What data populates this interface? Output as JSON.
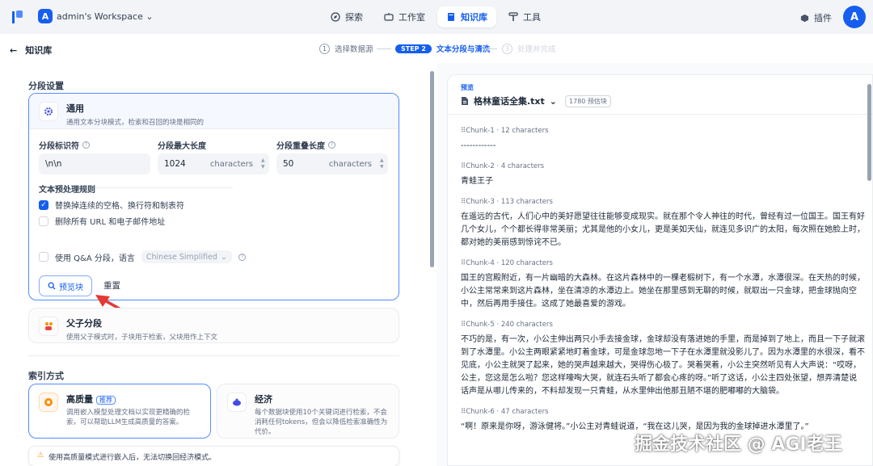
{
  "topbar": {
    "workspace_initial": "A",
    "workspace_name": "admin's Workspace",
    "nav": [
      {
        "label": "探索",
        "icon": "compass-icon"
      },
      {
        "label": "工作室",
        "icon": "studio-icon"
      },
      {
        "label": "知识库",
        "icon": "book-icon",
        "active": true
      },
      {
        "label": "工具",
        "icon": "tool-icon"
      }
    ],
    "plugin_label": "插件",
    "user_initial": "A"
  },
  "stepbar": {
    "back_label": "知识库",
    "step1_num": "1",
    "step1_label": "选择数据源",
    "step2_pill": "STEP 2",
    "step2_label": "文本分段与清洗",
    "step3_num": "3",
    "step3_label": "处理并完成"
  },
  "segment": {
    "section_title": "分段设置",
    "general_title": "通用",
    "general_desc": "通用文本分块模式，检索和召回的块是相同的",
    "separator_label": "分段标识符",
    "separator_value": "\\n\\n",
    "maxlen_label": "分段最大长度",
    "maxlen_value": "1024",
    "overlap_label": "分段重叠长度",
    "overlap_value": "50",
    "unit": "characters",
    "rules_title": "文本预处理规则",
    "rule1": "替换掉连续的空格、换行符和制表符",
    "rule2": "删除所有 URL 和电子邮件地址",
    "qa_label": "使用 Q&A 分段，语言",
    "qa_lang": "Chinese Simplified",
    "preview_btn": "预览块",
    "reset_btn": "重置",
    "parent_title": "父子分段",
    "parent_desc": "使用父子模式时，子块用于检索，父块用作上下文"
  },
  "index": {
    "section_title": "索引方式",
    "hq_title": "高质量",
    "hq_badge": "推荐",
    "hq_desc": "调用嵌入模型处理文档以实现更精确的检索，可以帮助LLM生成高质量的答案。",
    "eco_title": "经济",
    "eco_desc": "每个数据块使用10个关键词进行检索，不会消耗任何tokens，但会以降低检索准确性为代价。",
    "warning": "使用高质量模式进行嵌入后，无法切换回经济模式。"
  },
  "preview": {
    "label": "预览",
    "file_name": "格林童话全集.txt",
    "chunk_count": "1780 预估块",
    "chunks": [
      {
        "title": "Chunk-1",
        "chars": "12 characters",
        "text": "------------"
      },
      {
        "title": "Chunk-2",
        "chars": "4 characters",
        "text": "青蛙王子"
      },
      {
        "title": "Chunk-3",
        "chars": "113 characters",
        "text": "在遥远的古代，人们心中的美好愿望往往能够变成现实。就在那个令人神往的时代，曾经有过一位国王。国王有好几个女儿，个个都长得非常美丽；尤其是他的小女儿，更是美如天仙，就连见多识广的太阳，每次照在她脸上时，都对她的美丽感到惊诧不已。"
      },
      {
        "title": "Chunk-4",
        "chars": "120 characters",
        "text": "国王的宫殿附近，有一片幽暗的大森林。在这片森林中的一棵老椴树下，有一个水潭，水潭很深。在天热的时候，小公主常常来到这片森林，坐在清凉的水潭边上。她坐在那里感到无聊的时候，就取出一只金球，把金球抛向空中，然后再用手接住。这成了她最喜爱的游戏。"
      },
      {
        "title": "Chunk-5",
        "chars": "240 characters",
        "text": "不巧的是，有一次，小公主伸出两只小手去接金球，金球却没有落进她的手里，而是掉到了地上，而且一下子就滚到了水潭里。小公主两眼紧紧地盯着金球，可是金球忽地一下子在水潭里就没影儿了。因为水潭里的水很深，看不见底，小公主就哭了起来，她的哭声越来越大，哭得伤心极了。哭着哭着，小公主突然听见有人大声说：“哎呀，公主，您这是怎么啦？您这样嚎啕大哭，就连石头听了都会心疼的呀。”听了这话，小公主四处张望，想弄清楚说话声是从哪儿传来的，不料却发现一只青蛙，从水里伸出他那丑陋不堪的肥嘟嘟的大脑袋。"
      },
      {
        "title": "Chunk-6",
        "chars": "47 characters",
        "text": "“啊！原来是你呀，游泳健将。”小公主对青蛙说道，“我在这儿哭，是因为我的金球掉进水潭里了。”"
      }
    ]
  },
  "watermark": "掘金技术社区 @ AGI老王"
}
